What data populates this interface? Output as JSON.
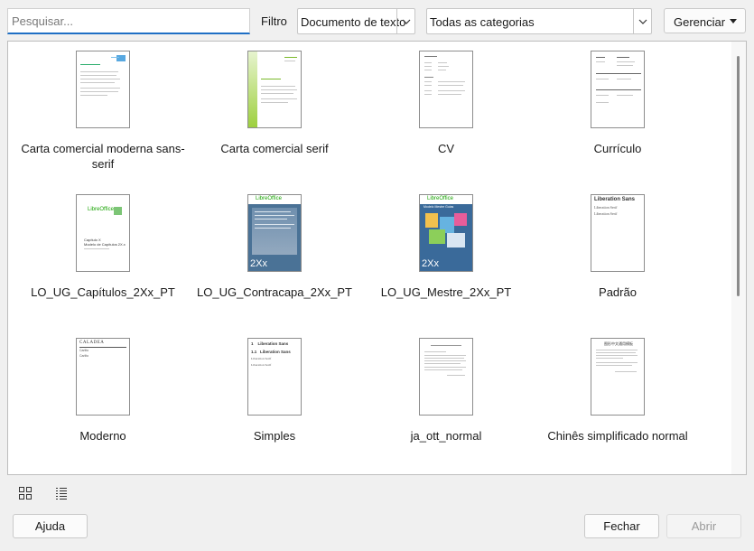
{
  "search": {
    "placeholder": "Pesquisar..."
  },
  "filter": {
    "label": "Filtro",
    "doc_type_value": "Documento de texto",
    "category_value": "Todas as categorias"
  },
  "manage_label": "Gerenciar",
  "templates": [
    {
      "label": "Carta comercial moderna sans-serif"
    },
    {
      "label": "Carta comercial serif"
    },
    {
      "label": "CV"
    },
    {
      "label": "Currículo"
    },
    {
      "label": "LO_UG_Capítulos_2Xx_PT",
      "thumb_text": "LibreOffice",
      "thumb_text2": "Capítulo X",
      "thumb_text3": "Modelo de Capítulos 2X.x"
    },
    {
      "label": "LO_UG_Contracapa_2Xx_PT",
      "thumb_text": "LibreOffice",
      "thumb_badge": "2Xx"
    },
    {
      "label": "LO_UG_Mestre_2Xx_PT",
      "thumb_text": "LibreOffice",
      "thumb_badge": "2Xx",
      "thumb_text2": "Modelo Mestre Guias"
    },
    {
      "label": "Padrão",
      "thumb_text": "Liberation Sans",
      "thumb_text2": "Liberation Serif",
      "thumb_text3": "Liberation Serif"
    },
    {
      "label": "Moderno",
      "thumb_text": "CALADEA",
      "thumb_text2": "Carlito",
      "thumb_text3": "Carlito"
    },
    {
      "label": "Simples",
      "thumb_text": "1    Liberation Sans",
      "thumb_text2": "1.1   Liberation Sans",
      "thumb_text3": "Liberation Serif",
      "thumb_text4": "Liberation Serif"
    },
    {
      "label": "ja_ott_normal"
    },
    {
      "label": "Chinês simplificado normal",
      "thumb_text": "图形中文通用模板"
    }
  ],
  "view_icons": [
    "grid-view-icon",
    "list-view-icon"
  ],
  "buttons": {
    "help": "Ajuda",
    "close": "Fechar",
    "open": "Abrir"
  },
  "colors": {
    "accent": "#1f6fc5",
    "lo_green": "#18a303",
    "lo_blue": "#2e5a87"
  }
}
